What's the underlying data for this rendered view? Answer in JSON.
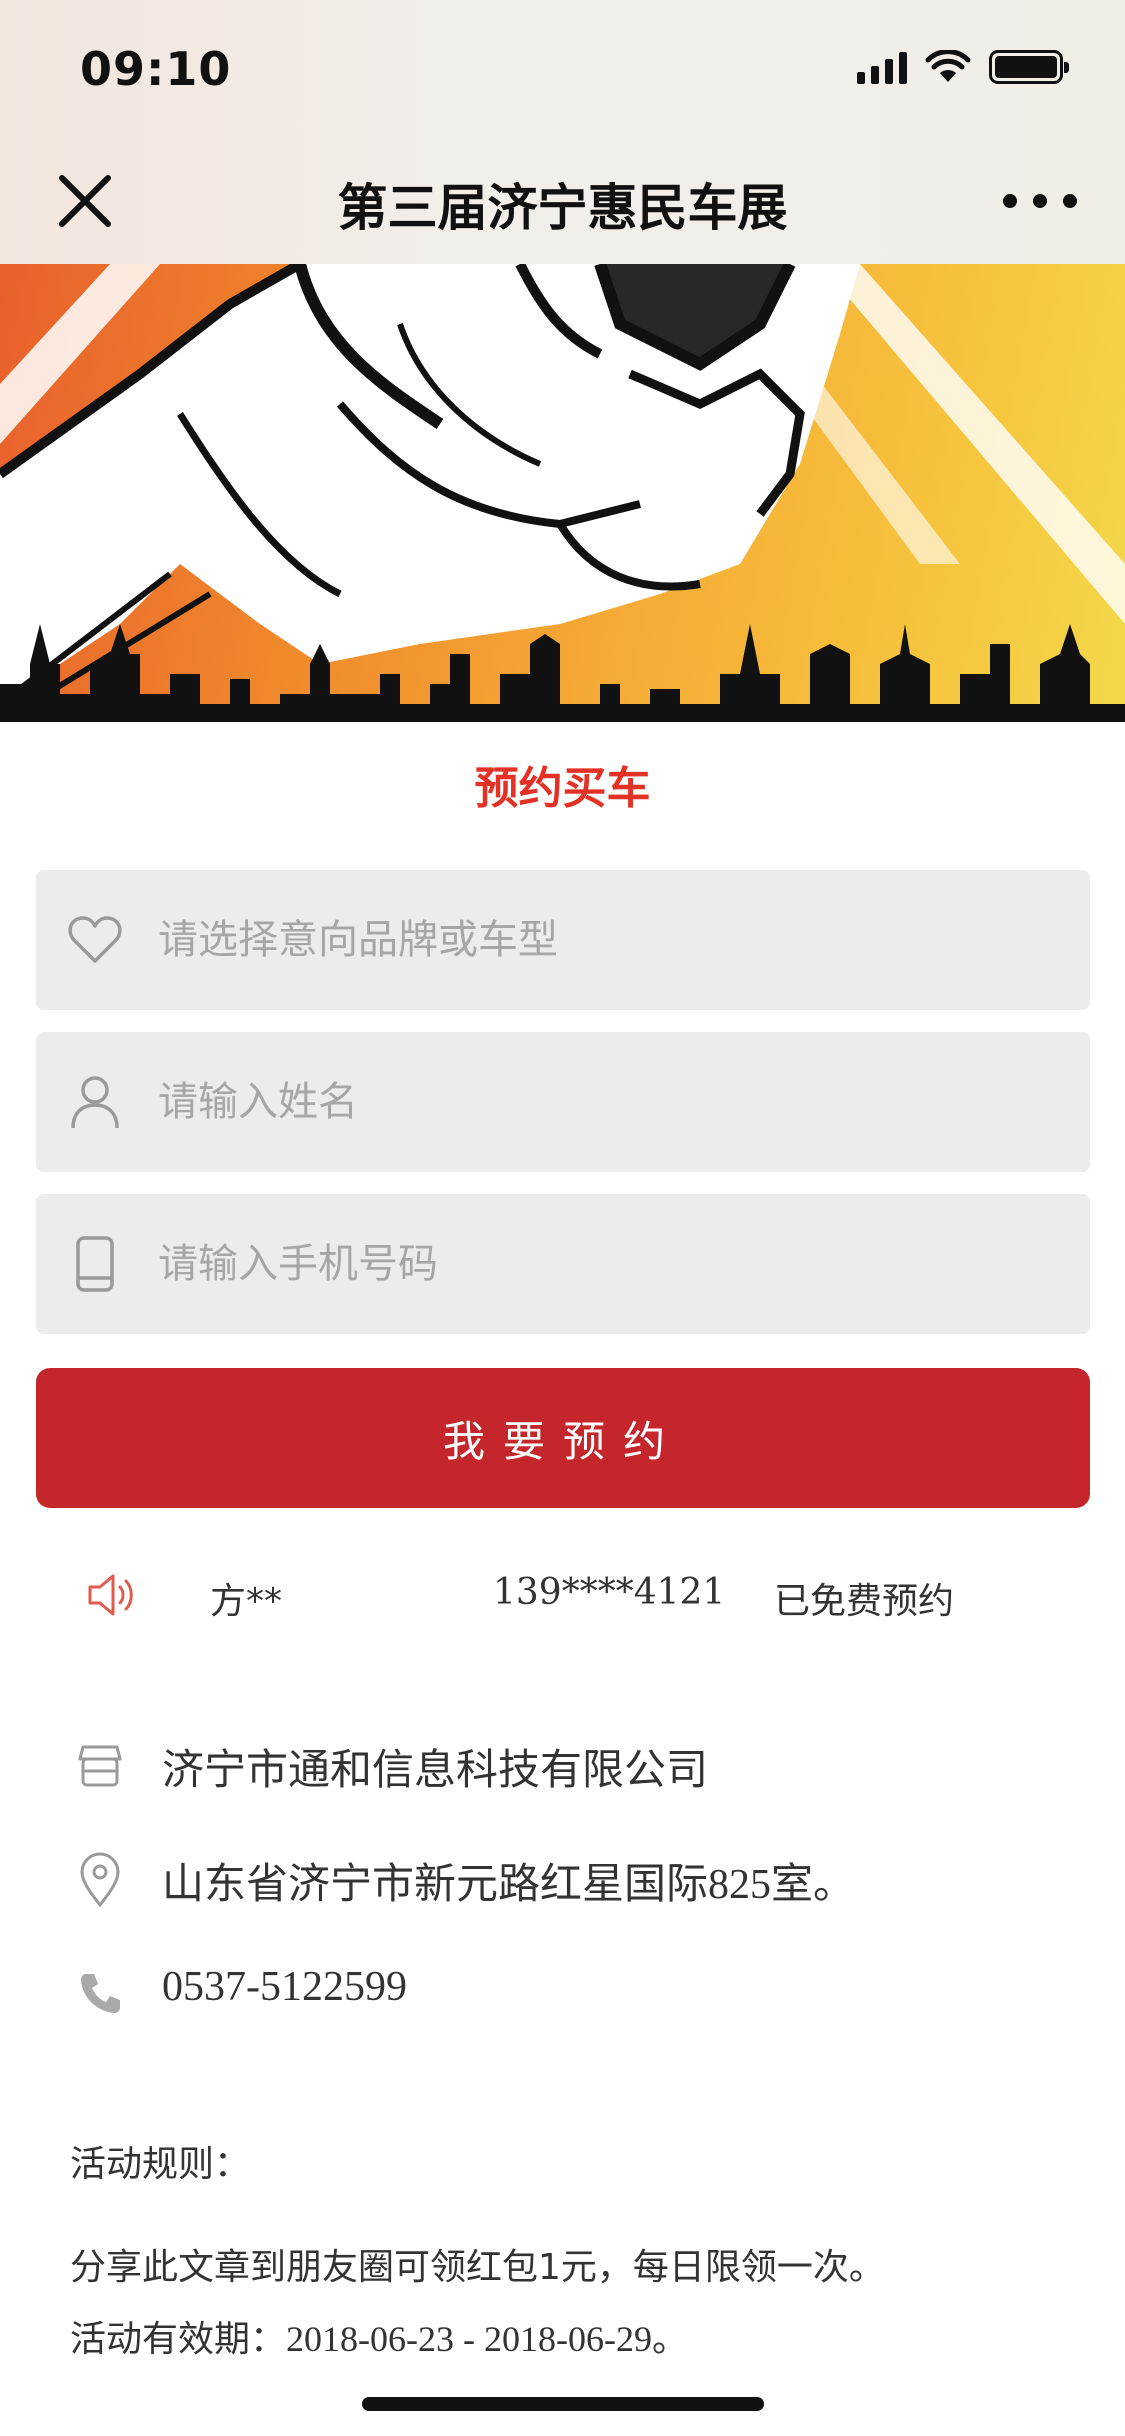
{
  "status_bar": {
    "time": "09:10"
  },
  "nav": {
    "title": "第三届济宁惠民车展",
    "close_icon": "close-icon",
    "more_icon": "more-icon"
  },
  "hero": {
    "colors": {
      "orange": "#e8602c",
      "yellow": "#f3d84a",
      "silhouette": "#111111"
    }
  },
  "form": {
    "title": "预约买车",
    "fields": [
      {
        "placeholder": "请选择意向品牌或车型",
        "value": "",
        "icon": "heart-icon"
      },
      {
        "placeholder": "请输入姓名",
        "value": "",
        "icon": "user-icon"
      },
      {
        "placeholder": "请输入手机号码",
        "value": "",
        "icon": "phone-device-icon"
      }
    ],
    "submit_label": "我要预约",
    "accent_color": "#c5262b"
  },
  "ticker": {
    "icon": "speaker-icon",
    "name": "方**",
    "phone": "139****4121",
    "status": "已免费预约"
  },
  "info": {
    "company": "济宁市通和信息科技有限公司",
    "address": "山东省济宁市新元路红星国际825室。",
    "phone": "0537-5122599",
    "icons": [
      "store-icon",
      "location-pin-icon",
      "telephone-icon"
    ]
  },
  "rules": {
    "title": "活动规则：",
    "lines": [
      "分享此文章到朋友圈可领红包1元，每日限领一次。",
      "活动有效期：2018-06-23 - 2018-06-29。"
    ]
  }
}
